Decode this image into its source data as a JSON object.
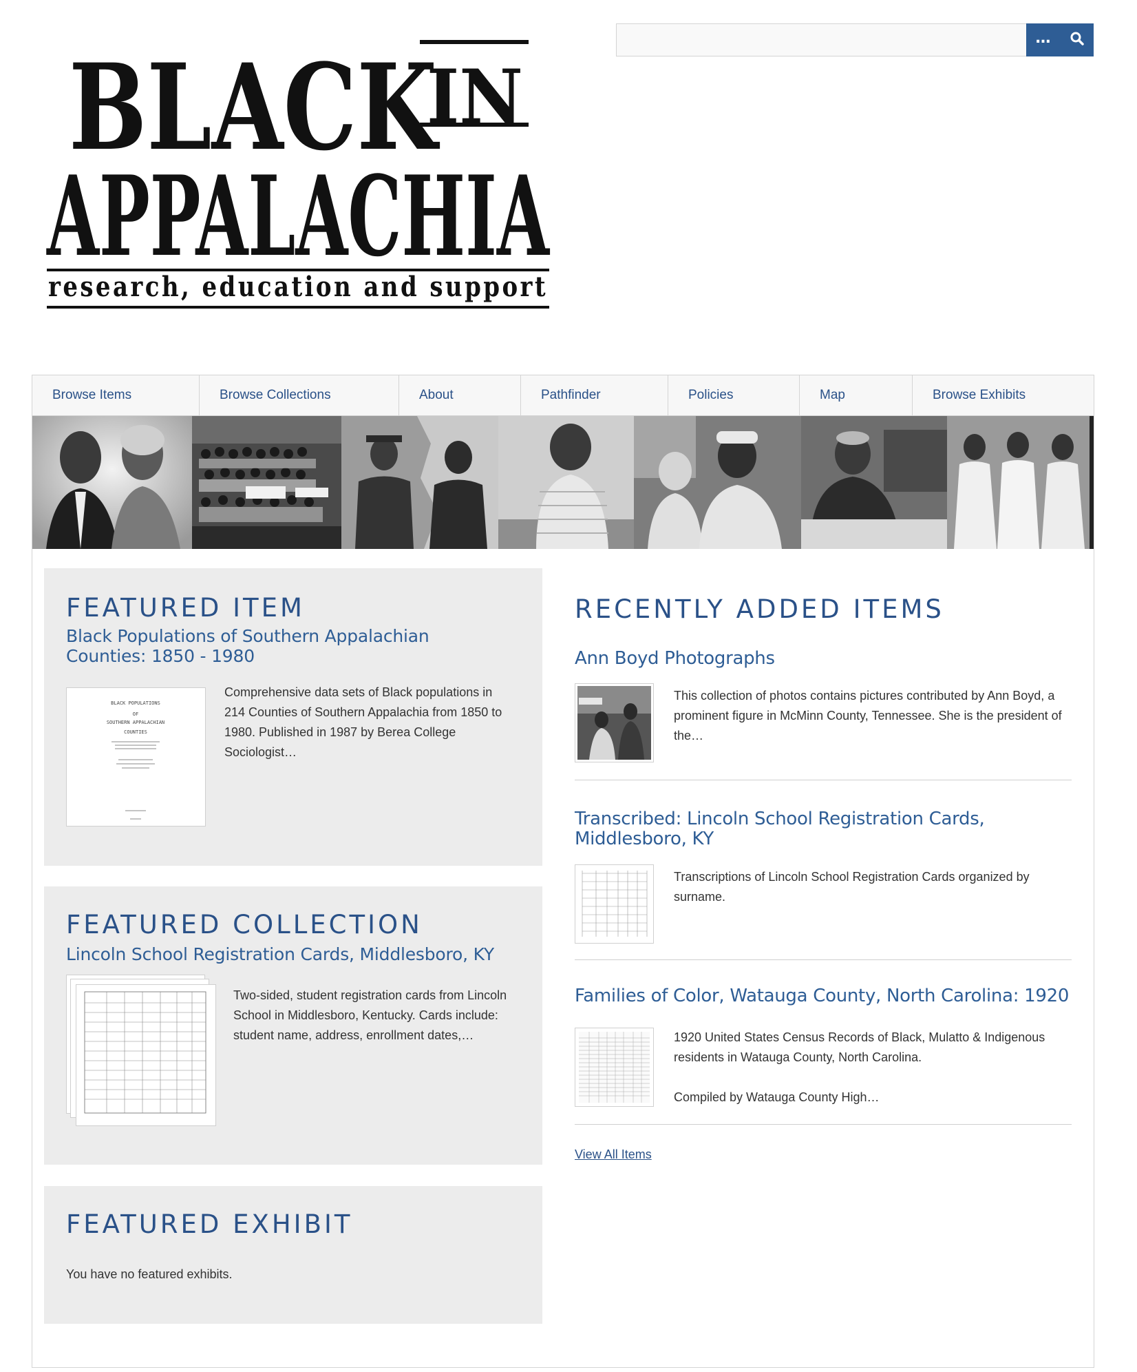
{
  "logo": {
    "line1": "BLACK",
    "line1_tag": "IN",
    "line2": "APPALACHIA",
    "tagline": "research, education and support"
  },
  "search": {
    "placeholder": "",
    "options_label": "…",
    "submit_icon": "search-icon"
  },
  "nav": {
    "items": [
      {
        "label": "Browse Items"
      },
      {
        "label": "Browse Collections"
      },
      {
        "label": "About"
      },
      {
        "label": "Pathfinder"
      },
      {
        "label": "Policies"
      },
      {
        "label": "Map"
      },
      {
        "label": "Browse Exhibits"
      }
    ]
  },
  "featured_item": {
    "heading": "FEATURED ITEM",
    "title": "Black Populations of Southern Appalachian Counties: 1850 - 1980",
    "description": "Comprehensive data sets of Black populations in 214 Counties of Southern Appalachia from 1850 to 1980. Published in 1987 by Berea College Sociologist…",
    "thumb_text": {
      "line1": "BLACK POPULATIONS",
      "line2": "OF",
      "line3": "SOUTHERN APPALACHIAN",
      "line4": "COUNTIES"
    }
  },
  "featured_collection": {
    "heading": "FEATURED COLLECTION",
    "title": "Lincoln School Registration Cards, Middlesboro, KY",
    "description": "Two-sided, student registration cards from Lincoln School in Middlesboro, Kentucky. Cards include: student name, address, enrollment dates,…"
  },
  "featured_exhibit": {
    "heading": "FEATURED EXHIBIT",
    "message": "You have no featured exhibits."
  },
  "recent": {
    "heading": "RECENTLY ADDED ITEMS",
    "items": [
      {
        "title": "Ann Boyd Photographs",
        "description": "This collection of photos contains pictures contributed by Ann Boyd, a prominent figure in McMinn County, Tennessee. She is the president of the…"
      },
      {
        "title": "Transcribed: Lincoln School Registration Cards, Middlesboro, KY",
        "description": "Transcriptions of Lincoln School Registration Cards organized by surname."
      },
      {
        "title": "Families of Color, Watauga County, North Carolina: 1920",
        "description": "1920 United States Census Records of Black, Mulatto & Indigenous residents in Watauga County, North Carolina.",
        "description2": "Compiled by Watauga County High…"
      }
    ],
    "view_all": "View All Items"
  },
  "colors": {
    "accent": "#2a5188",
    "button": "#2e5d95",
    "panel": "#ececec"
  }
}
